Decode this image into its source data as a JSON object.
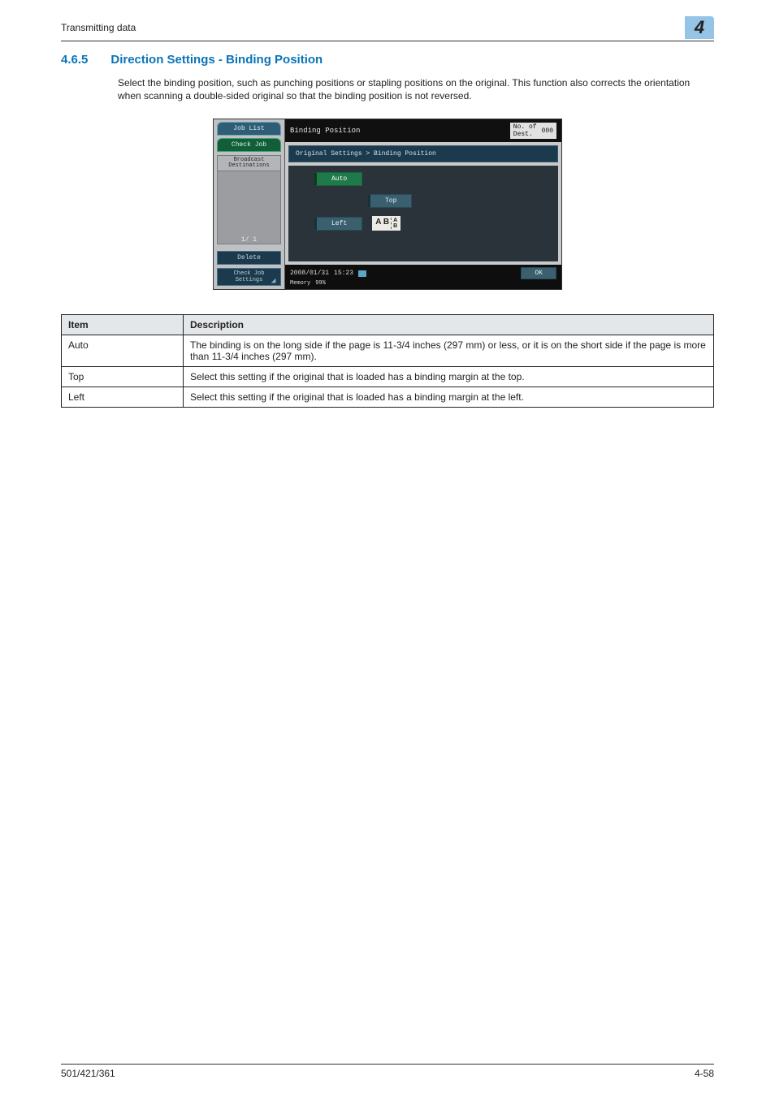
{
  "header": {
    "running_head": "Transmitting data",
    "chapter_number": "4"
  },
  "section": {
    "number": "4.6.5",
    "title": "Direction Settings - Binding Position",
    "paragraph": "Select the binding position, such as punching positions or stapling positions on the original. This function also corrects the orientation when scanning a double-sided original so that the binding position is not reversed."
  },
  "screenshot": {
    "left_tabs": {
      "job_list": "Job List",
      "check_job": "Check Job"
    },
    "left_panel_label": "Broadcast\nDestinations",
    "pager": "1/  1",
    "delete": "Delete",
    "check_job_settings": "Check Job\nSettings",
    "title": "Binding Position",
    "dest_count_label": "No. of\nDest.",
    "dest_count_value": "000",
    "crumb": "Original Settings > Binding Position",
    "options": {
      "auto": "Auto",
      "top": "Top",
      "left": "Left"
    },
    "glyph_left": "A B",
    "glyph_stack_a": "A",
    "glyph_stack_b": "B",
    "status_date": "2008/01/31",
    "status_time": "15:23",
    "status_mem_label": "Memory",
    "status_mem_value": "99%",
    "ok": "OK"
  },
  "table": {
    "headers": {
      "item": "Item",
      "description": "Description"
    },
    "rows": [
      {
        "item": "Auto",
        "desc": "The binding is on the long side if the page is 11-3/4 inches (297 mm) or less, or it is on the short side if the page is more than 11-3/4 inches (297 mm)."
      },
      {
        "item": "Top",
        "desc": "Select this setting if the original that is loaded has a binding margin at the top."
      },
      {
        "item": "Left",
        "desc": "Select this setting if the original that is loaded has a binding margin at the left."
      }
    ]
  },
  "footer": {
    "model": "501/421/361",
    "page": "4-58"
  }
}
